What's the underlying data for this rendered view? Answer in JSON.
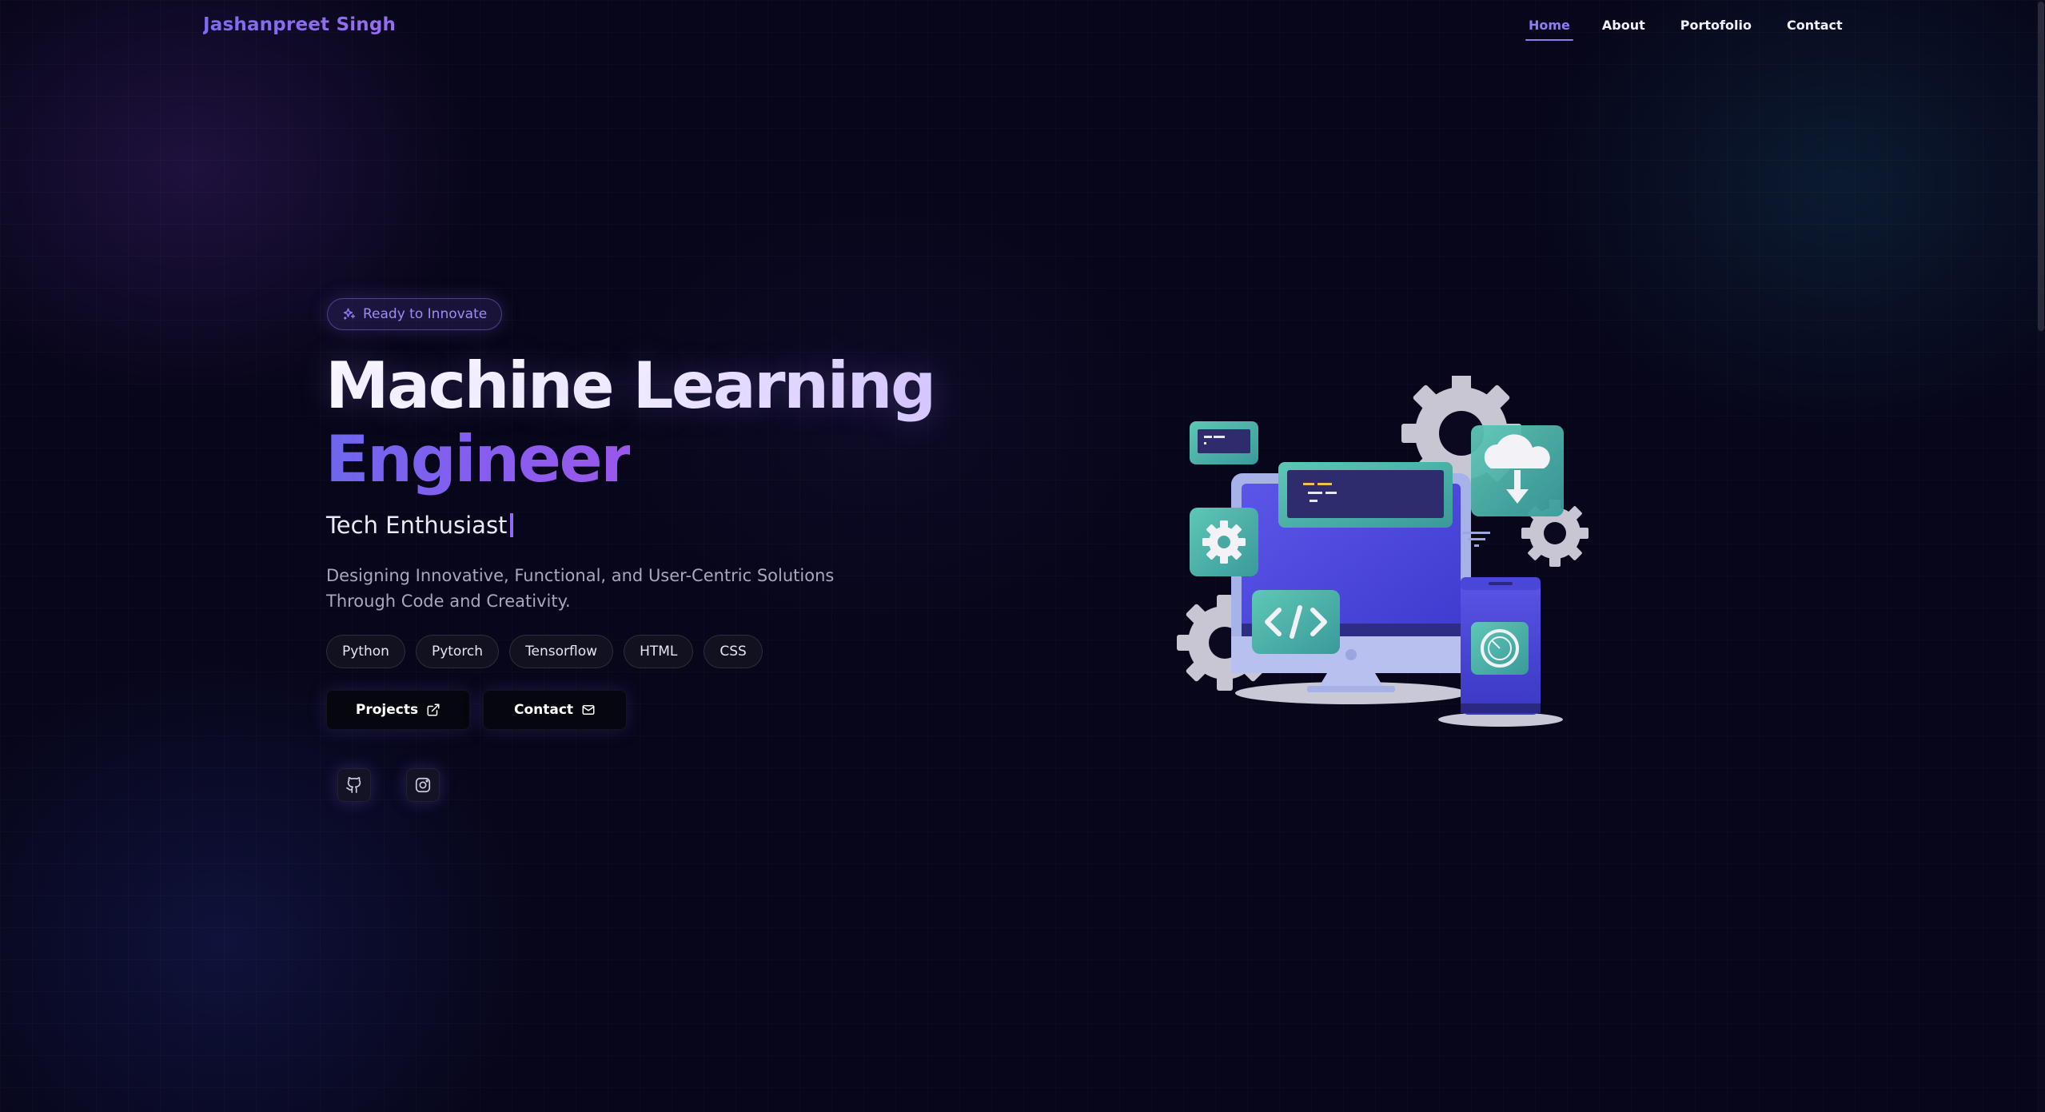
{
  "header": {
    "brand": "Jashanpreet Singh",
    "nav": [
      {
        "label": "Home",
        "active": true
      },
      {
        "label": "About",
        "active": false
      },
      {
        "label": "Portofolio",
        "active": false
      },
      {
        "label": "Contact",
        "active": false
      }
    ]
  },
  "hero": {
    "badge": "Ready to Innovate",
    "title_line1": "Machine Learning",
    "title_line2": "Engineer",
    "subtitle": "Tech Enthusiast",
    "description": "Designing Innovative, Functional, and User-Centric Solutions Through Code and Creativity.",
    "skills": [
      "Python",
      "Pytorch",
      "Tensorflow",
      "HTML",
      "CSS"
    ],
    "buttons": {
      "projects": "Projects",
      "contact": "Contact"
    },
    "socials": [
      {
        "icon": "github-icon"
      },
      {
        "icon": "instagram-icon"
      }
    ],
    "illustration": "devices-gears-illustration"
  },
  "colors": {
    "background": "#07061a",
    "accent": "#8d7cf6",
    "accent_purple": "#9a58ea",
    "teal": "#4fb3a8"
  }
}
